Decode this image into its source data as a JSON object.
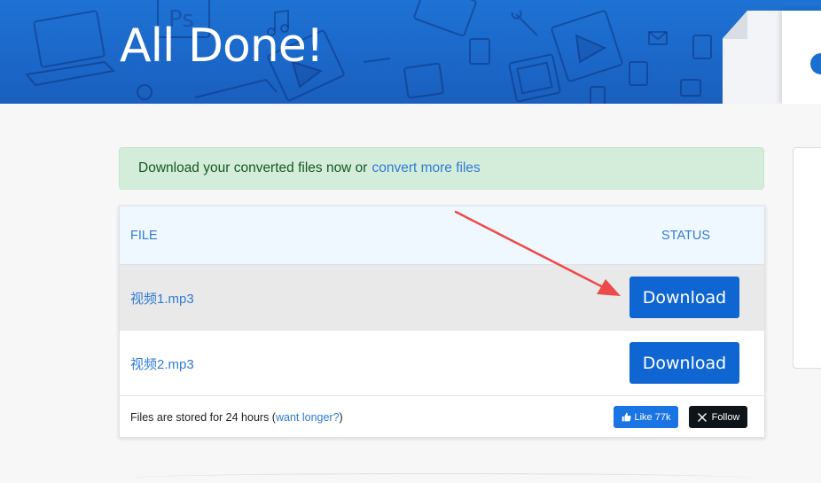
{
  "hero": {
    "title": "All Done!",
    "decorations": [
      "laptop-icon",
      "ps-file-icon",
      "music-note-icon",
      "video-file-icon",
      "wrench-icon",
      "mail-icon",
      "image-file-icon",
      "film-strip-icon",
      "mp3-file-icon"
    ]
  },
  "alert": {
    "text": "Download your converted files now or",
    "link": "convert more files"
  },
  "table": {
    "headers": {
      "file": "FILE",
      "status": "STATUS"
    },
    "rows": [
      {
        "file": "视频1.mp3",
        "action": "Download",
        "highlighted": true
      },
      {
        "file": "视频2.mp3",
        "action": "Download",
        "highlighted": false
      }
    ],
    "footer": {
      "text_before": "Files are stored for 24 hours (",
      "link": "want longer?",
      "text_after": ")"
    },
    "social": {
      "like": {
        "icon": "thumbs-up-icon",
        "label": "Like 77k"
      },
      "follow": {
        "icon": "x-logo-icon",
        "label": "Follow"
      }
    }
  },
  "colors": {
    "hero_blue": "#1b67c8",
    "button_blue": "#0f66d2",
    "link_blue": "#2f7bd3",
    "alert_green": "#d4eddb",
    "annotation_red": "#ee4a4a"
  }
}
